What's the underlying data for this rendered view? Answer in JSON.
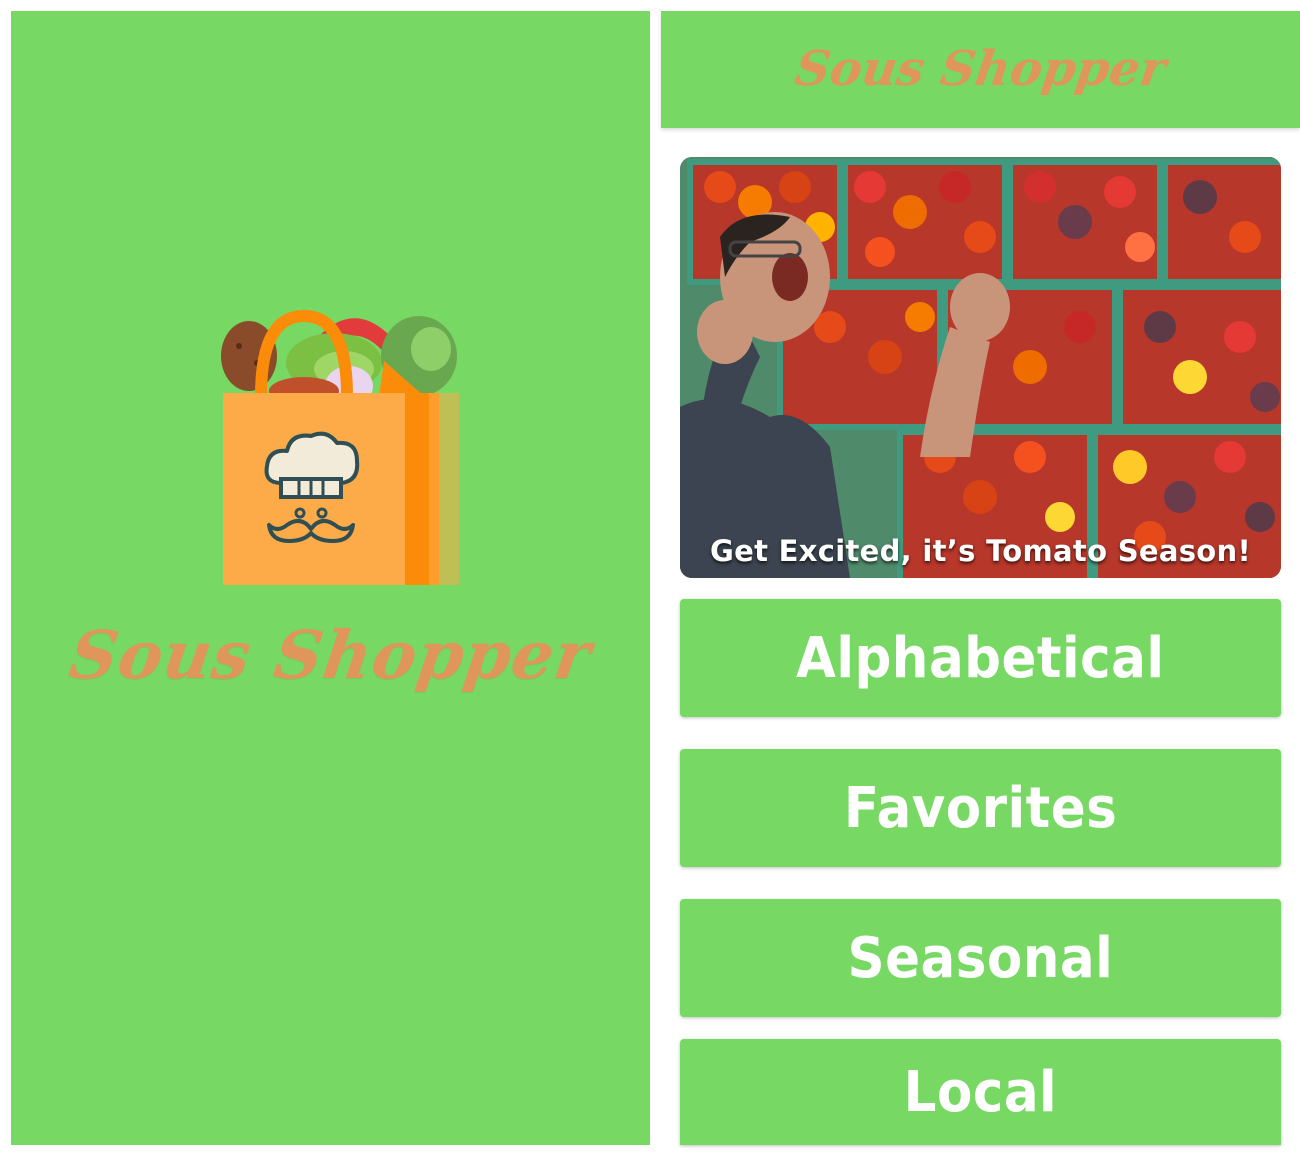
{
  "splash": {
    "title": "Sous Shopper"
  },
  "home": {
    "header_title": "Sous Shopper",
    "hero_caption": "Get Excited, it’s Tomato Season!",
    "nav": [
      {
        "label": "Alphabetical"
      },
      {
        "label": "Favorites"
      },
      {
        "label": "Seasonal"
      },
      {
        "label": "Local"
      }
    ]
  },
  "colors": {
    "brand_green": "#77d864",
    "title_orange": "#e0955b",
    "bag_orange": "#fdab48",
    "bag_dark_orange": "#fb8c0a",
    "tomato_red": "#e23b20"
  },
  "icons": {
    "logo": "shopping-bag-chef-icon"
  }
}
